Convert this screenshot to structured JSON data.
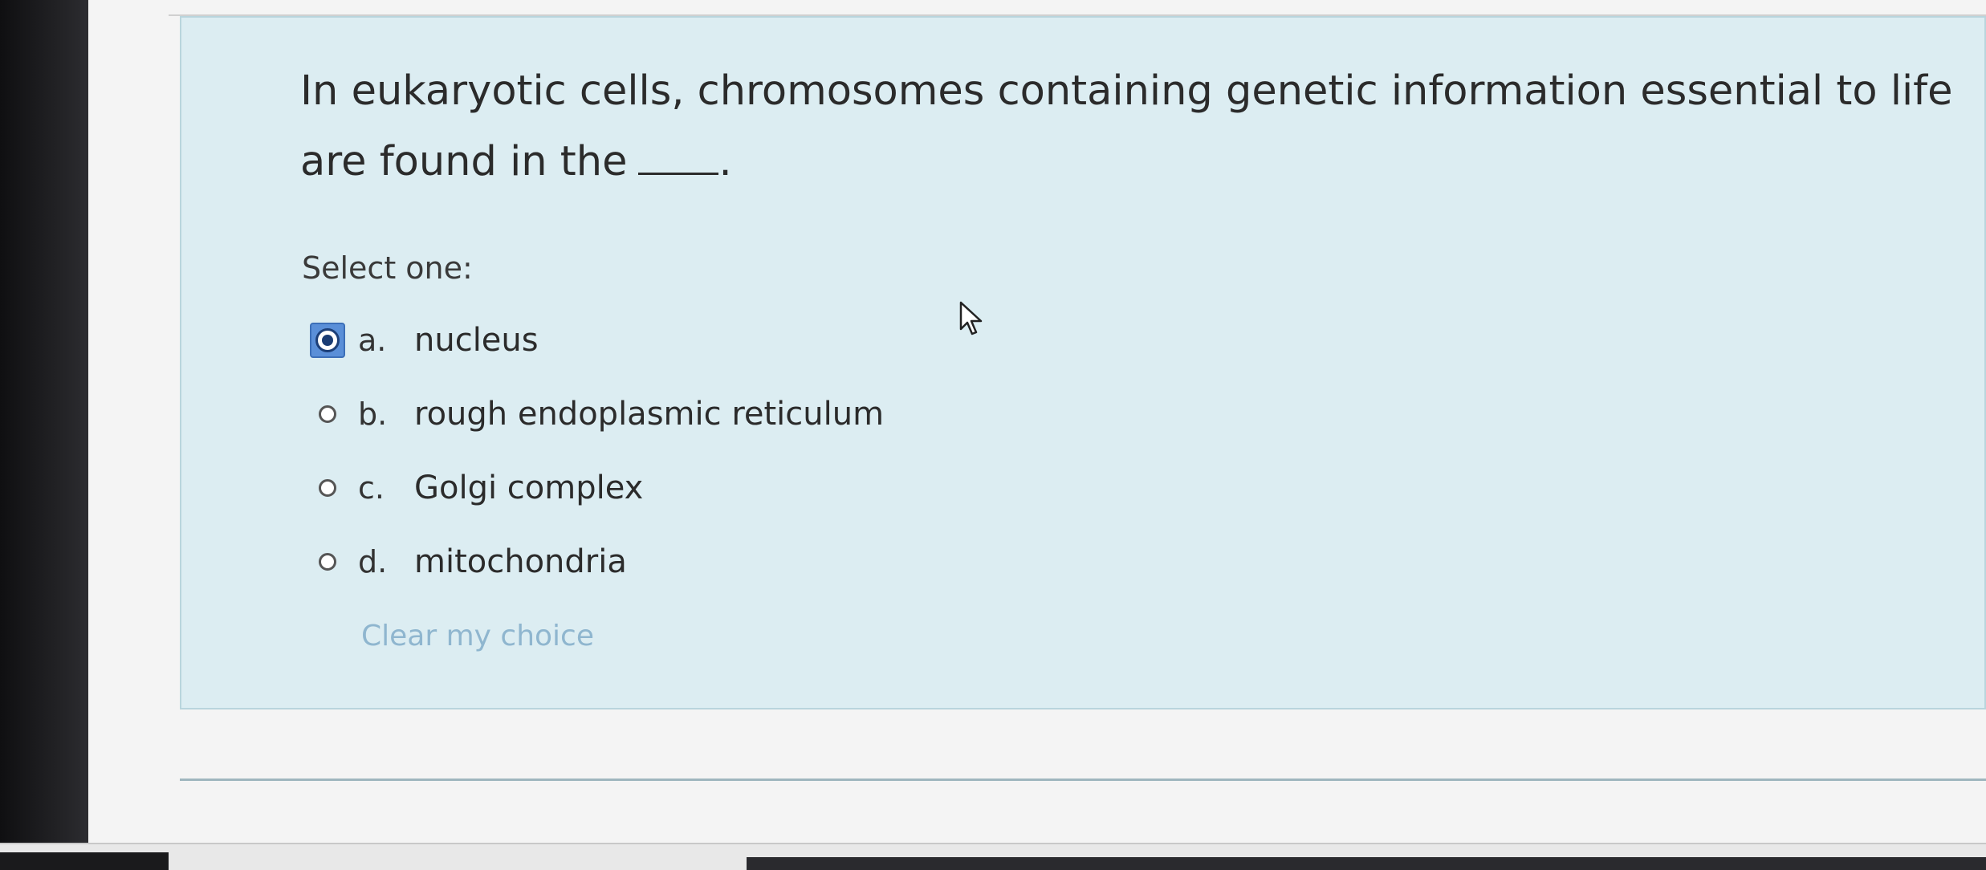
{
  "question": {
    "text_before_blank": "In eukaryotic cells, chromosomes containing genetic information essential to life are found in the",
    "text_after_blank": "."
  },
  "select_label": "Select one:",
  "options": [
    {
      "letter": "a.",
      "text": "nucleus",
      "selected": true
    },
    {
      "letter": "b.",
      "text": "rough endoplasmic reticulum",
      "selected": false
    },
    {
      "letter": "c.",
      "text": "Golgi complex",
      "selected": false
    },
    {
      "letter": "d.",
      "text": "mitochondria",
      "selected": false
    }
  ],
  "clear_choice_label": "Clear my choice",
  "icons": {
    "pointer": "mouse-pointer-icon",
    "radio": "radio-icon"
  },
  "colors": {
    "question_background": "#dcedf2",
    "selected_radio_highlight": "#5a8fd8",
    "clear_link": "#8fb6cf"
  }
}
